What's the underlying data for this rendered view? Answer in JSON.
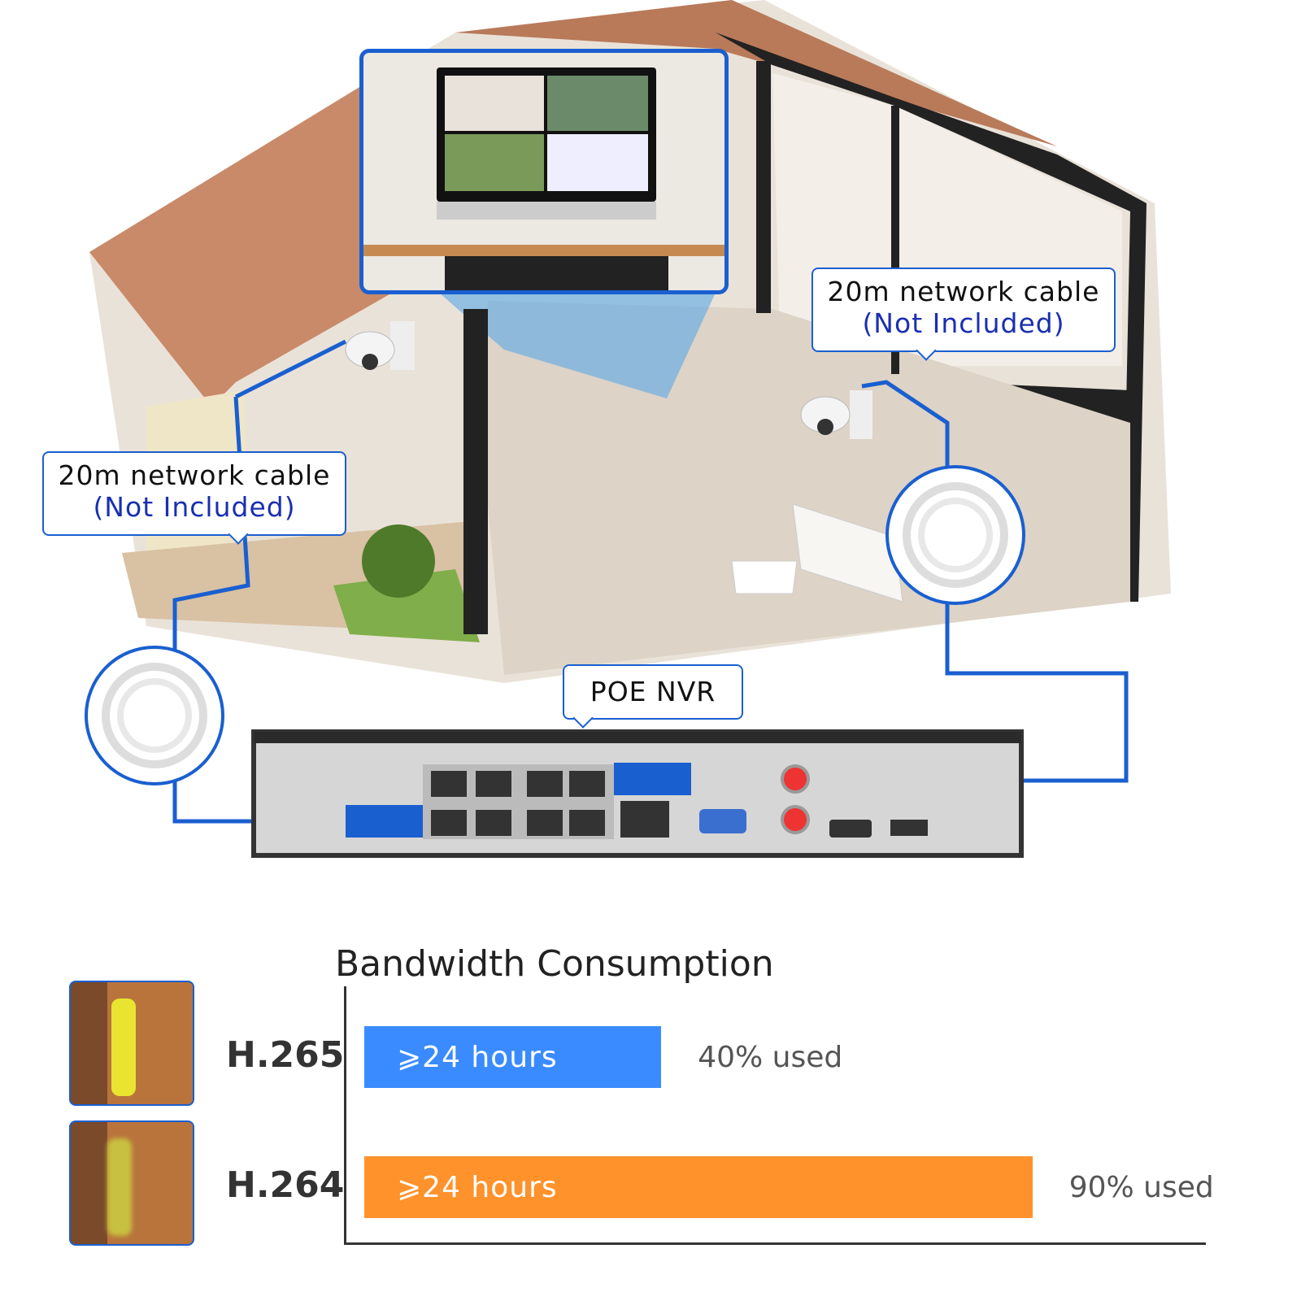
{
  "callouts": {
    "left": {
      "line1": "20m network cable",
      "line2": "(Not Included)"
    },
    "right": {
      "line1": "20m network cable",
      "line2": "(Not Included)"
    },
    "nvr": "POE NVR"
  },
  "colors": {
    "accent_blue": "#1a5fd0",
    "h265_bar": "#3a8bff",
    "h264_bar": "#ff922b",
    "label_blue": "#1a2fb0"
  },
  "chart_data": {
    "type": "bar",
    "title": "Bandwidth Consumption",
    "orientation": "horizontal",
    "categories": [
      "H.265",
      "H.264"
    ],
    "values": [
      40,
      90
    ],
    "unit": "% used",
    "bar_labels": [
      "⩾24 hours",
      "⩾24 hours"
    ],
    "value_labels": [
      "40% used",
      "90% used"
    ],
    "colors": [
      "#3a8bff",
      "#ff922b"
    ],
    "xlim": [
      0,
      100
    ]
  }
}
